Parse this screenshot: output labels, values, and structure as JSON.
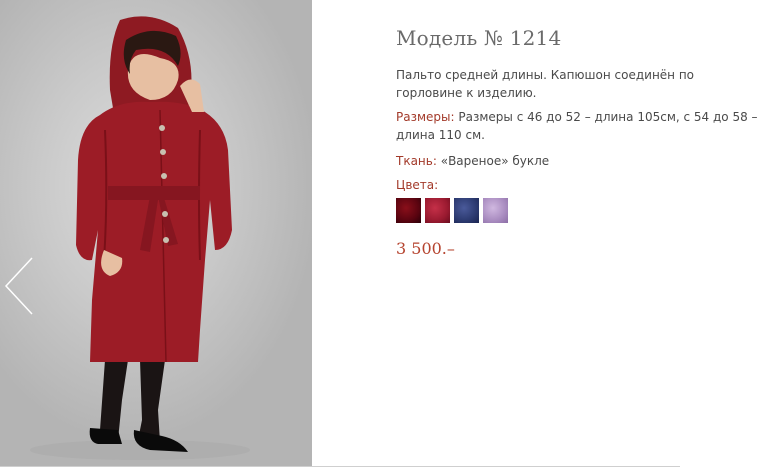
{
  "product": {
    "title": "Модель № 1214",
    "description": "Пальто средней длины. Капюшон соединён по горловине к изделию.",
    "sizes_label": "Размеры:",
    "sizes_value": "Размеры с 46 до 52 – длина 105см, с 54 до 58 – длина 110 см.",
    "fabric_label": "Ткань:",
    "fabric_value": "«Вареное» букле",
    "colors_label": "Цвета:",
    "colors": [
      {
        "name": "dark-red",
        "hex": "#6a0612"
      },
      {
        "name": "red",
        "hex": "#a8203a"
      },
      {
        "name": "navy-blue",
        "hex": "#2e3c74"
      },
      {
        "name": "lilac",
        "hex": "#b49bcb"
      }
    ],
    "price": "3 500.–"
  },
  "gallery": {
    "prev_icon": "chevron-left-icon"
  },
  "accent_color": "#a33a2a"
}
